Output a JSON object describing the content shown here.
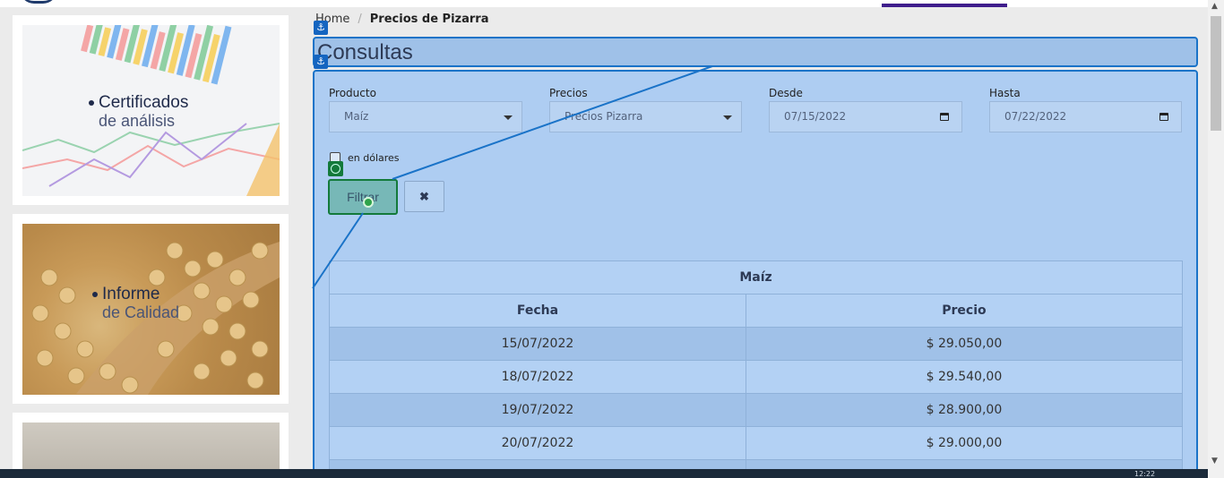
{
  "breadcrumb": {
    "home": "Home",
    "separator": "/",
    "current": "Precios de Pizarra"
  },
  "page": {
    "title": "Consultas"
  },
  "sidebar": {
    "cards": [
      {
        "line1": "Certificados",
        "line2": "de análisis"
      },
      {
        "line1": "Informe",
        "line2": "de Calidad"
      },
      {
        "line1": "",
        "line2": ""
      }
    ]
  },
  "form": {
    "producto": {
      "label": "Producto",
      "value": "Maíz"
    },
    "precios": {
      "label": "Precios",
      "value": "Precios Pizarra"
    },
    "desde": {
      "label": "Desde",
      "value": "07/15/2022"
    },
    "hasta": {
      "label": "Hasta",
      "value": "07/22/2022"
    },
    "dolares": {
      "label": "en dólares",
      "checked": false
    },
    "filter_label": "Filtrar",
    "clear_icon": "✖"
  },
  "table": {
    "caption": "Maíz",
    "headers": [
      "Fecha",
      "Precio"
    ],
    "rows": [
      [
        "15/07/2022",
        "$ 29.050,00"
      ],
      [
        "18/07/2022",
        "$ 29.540,00"
      ],
      [
        "19/07/2022",
        "$ 28.900,00"
      ],
      [
        "20/07/2022",
        "$ 29.000,00"
      ]
    ]
  },
  "taskbar": {
    "clock": "12:22"
  },
  "colors": {
    "accent": "#1a73c8",
    "highlight": "#aecdf2",
    "filter_focus": "#137a3b",
    "nav_active": "#3f1d8c"
  }
}
